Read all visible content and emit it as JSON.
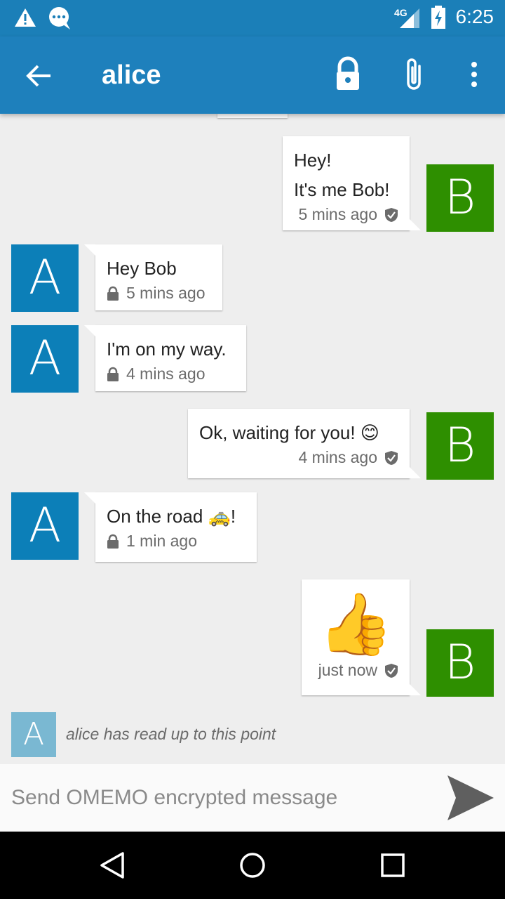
{
  "status_bar": {
    "network": "4G",
    "time": "6:25",
    "icons": [
      "warning-icon",
      "chat-bubble-icon",
      "signal-icon",
      "battery-charging-icon"
    ]
  },
  "app_bar": {
    "title": "alice",
    "icons": [
      "back-arrow-icon",
      "lock-icon",
      "attachment-icon",
      "more-vert-icon"
    ]
  },
  "messages": [
    {
      "from": "me",
      "avatar": "B",
      "lines": [
        "Hey!",
        "It's me Bob!"
      ],
      "time": "5 mins ago",
      "status_icon": "shield-check-icon"
    },
    {
      "from": "alice",
      "avatar": "A",
      "lines": [
        "Hey Bob"
      ],
      "time": "5 mins ago",
      "status_icon": "lock-icon"
    },
    {
      "from": "alice",
      "avatar": "A",
      "lines": [
        "I'm on my way."
      ],
      "time": "4 mins ago",
      "status_icon": "lock-icon"
    },
    {
      "from": "me",
      "avatar": "B",
      "lines": [
        "Ok, waiting for you! 😊"
      ],
      "time": "4 mins ago",
      "status_icon": "shield-check-icon"
    },
    {
      "from": "alice",
      "avatar": "A",
      "lines": [
        "On the road 🚕!"
      ],
      "time": "1 min ago",
      "status_icon": "lock-icon"
    },
    {
      "from": "me",
      "avatar": "B",
      "lines": [
        "👍"
      ],
      "time": "just now",
      "status_icon": "shield-check-icon"
    }
  ],
  "read_marker": {
    "avatar": "A",
    "text": "alice has read up to this point"
  },
  "composer": {
    "placeholder": "Send OMEMO encrypted message"
  },
  "nav_bar": {
    "icons": [
      "back-triangle-icon",
      "home-circle-icon",
      "recents-square-icon"
    ]
  },
  "colors": {
    "app_bar": "#1e80bc",
    "avatar_alice": "#0c7fb8",
    "avatar_bob": "#2e8f00",
    "background": "#eeeeee"
  }
}
